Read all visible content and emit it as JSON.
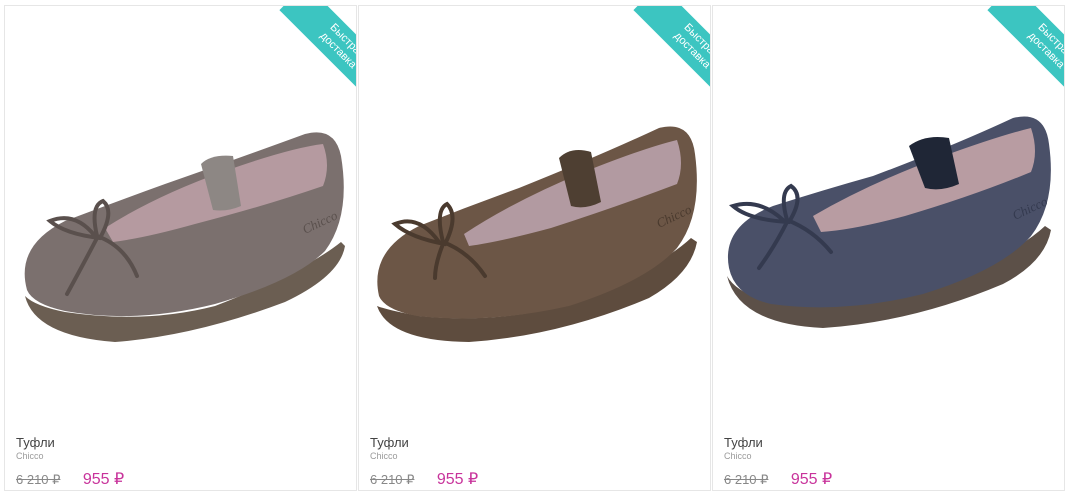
{
  "accent_colors": {
    "ribbon": "#3cc5c1",
    "price": "#c8339b"
  },
  "products": [
    {
      "badge_line1": "Быстрая",
      "badge_line2": "доставка",
      "title": "Туфли",
      "brand": "Chicco",
      "old_price": "6 210 ₽",
      "new_price": "955 ₽",
      "image_label": "Chicco",
      "colors": {
        "suede": "#7b706e",
        "dark": "#5a504d",
        "strap": "#8d8784",
        "lining": "#b59aa0",
        "sole": "#6b5e52"
      }
    },
    {
      "badge_line1": "Быстрая",
      "badge_line2": "доставка",
      "title": "Туфли",
      "brand": "Chicco",
      "old_price": "6 210 ₽",
      "new_price": "955 ₽",
      "image_label": "Chicco",
      "colors": {
        "suede": "#6c5646",
        "dark": "#4a3a2e",
        "strap": "#4e3f32",
        "lining": "#b29aa1",
        "sole": "#5e4c3e"
      }
    },
    {
      "badge_line1": "Быстрая",
      "badge_line2": "доставка",
      "title": "Туфли",
      "brand": "Chicco",
      "old_price": "6 210 ₽",
      "new_price": "955 ₽",
      "image_label": "Chicco",
      "colors": {
        "suede": "#4a5068",
        "dark": "#343a4f",
        "strap": "#1f2636",
        "lining": "#b89ca2",
        "sole": "#5c5048"
      }
    }
  ]
}
